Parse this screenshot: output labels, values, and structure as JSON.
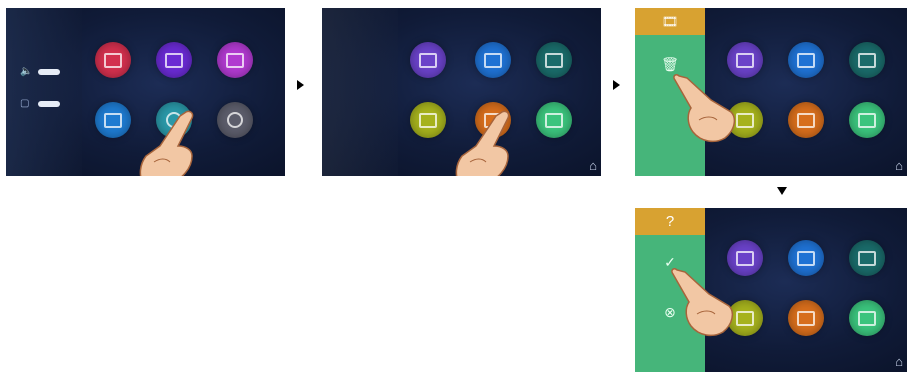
{
  "screens": [
    {
      "name": "main-menu",
      "volume_glyphs": [
        "🔈",
        "▢"
      ],
      "icons": [
        {
          "name": "intercom-icon",
          "color": "#d3304e"
        },
        {
          "name": "settings-icon",
          "color": "#6a2bd3"
        },
        {
          "name": "location-icon",
          "color": "#b13ad0"
        },
        {
          "name": "monitor-icon",
          "color": "#1e7bd1"
        },
        {
          "name": "media-icon",
          "color": "#2a98a8"
        },
        {
          "name": "power-icon",
          "color": "#5c5d6b"
        }
      ]
    },
    {
      "name": "media-menu",
      "icons": [
        {
          "name": "music-icon",
          "color": "#6a42c9"
        },
        {
          "name": "video-record-icon",
          "color": "#1f72d4"
        },
        {
          "name": "camera-icon",
          "color": "#1a6b6a"
        },
        {
          "name": "photo-icon",
          "color": "#a6b21d"
        },
        {
          "name": "video-icon",
          "color": "#d76e1c"
        },
        {
          "name": "file-icon",
          "color": "#3bc47d"
        }
      ],
      "home_glyph": "⌂"
    },
    {
      "name": "media-side-menu",
      "top_glyph": "🎞",
      "menu_glyphs": [
        "🗑"
      ],
      "home_glyph": "⌂"
    },
    {
      "name": "delete-confirm-menu",
      "top_glyph": "?",
      "menu_glyphs": [
        "✓",
        "⊗"
      ],
      "home_glyph": "⌂"
    }
  ],
  "colors": {
    "menu_green": "#46b57a",
    "menu_orange": "#d8a231",
    "hand": "#f2c7a4"
  }
}
